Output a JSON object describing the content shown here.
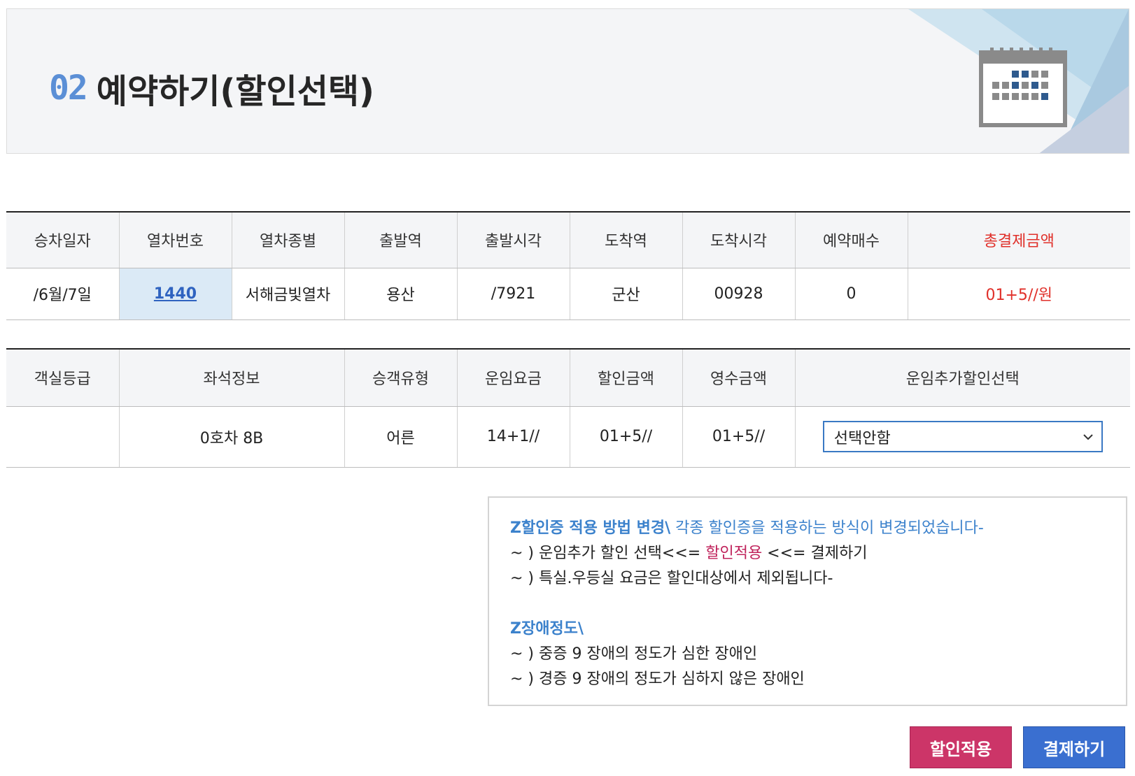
{
  "header": {
    "step": "02",
    "title": "예약하기(할인선택)",
    "icon": "calendar-icon"
  },
  "booking_table": {
    "headers": [
      "승차일자",
      "열차번호",
      "열차종별",
      "출발역",
      "출발시각",
      "도착역",
      "도착시각",
      "예약매수",
      "총결제금액"
    ],
    "row": {
      "date": "/6월/7일",
      "train_no": "1440",
      "train_type": "서해금빛열차",
      "dep_station": "용산",
      "dep_time": "/7921",
      "arr_station": "군산",
      "arr_time": "00928",
      "count": "0",
      "total": "01+5//원"
    }
  },
  "fare_table": {
    "headers": [
      "객실등급",
      "좌석정보",
      "승객유형",
      "운임요금",
      "할인금액",
      "영수금액",
      "운임추가할인선택"
    ],
    "row": {
      "class": "",
      "seat": "0호차 8B",
      "passenger": "어른",
      "fare": "14+1//",
      "discount": "01+5//",
      "received": "01+5//",
      "select_value": "선택안함"
    }
  },
  "notice": {
    "h1_bold": "Z할인증 적용 방법 변경\\",
    "h1_rest": " 각종 할인증을 적용하는 방식이 변경되었습니다-",
    "l1_a": "~ ) 운임추가 할인 선택<<= ",
    "l1_pink": "할인적용",
    "l1_b": " <<= 결제하기",
    "l2": "~ ) 특실.우등실 요금은 할인대상에서 제외됩니다-",
    "h2": "Z장애정도\\",
    "l3": "~ ) 중증 9 장애의 정도가 심한 장애인",
    "l4": "~ ) 경증 9 장애의 정도가 심하지 않은 장애인"
  },
  "buttons": {
    "apply_discount": "할인적용",
    "pay": "결제하기"
  },
  "colors": {
    "accent_blue": "#3a6fd0",
    "accent_pink": "#cc3568",
    "total_red": "#e0302a"
  }
}
